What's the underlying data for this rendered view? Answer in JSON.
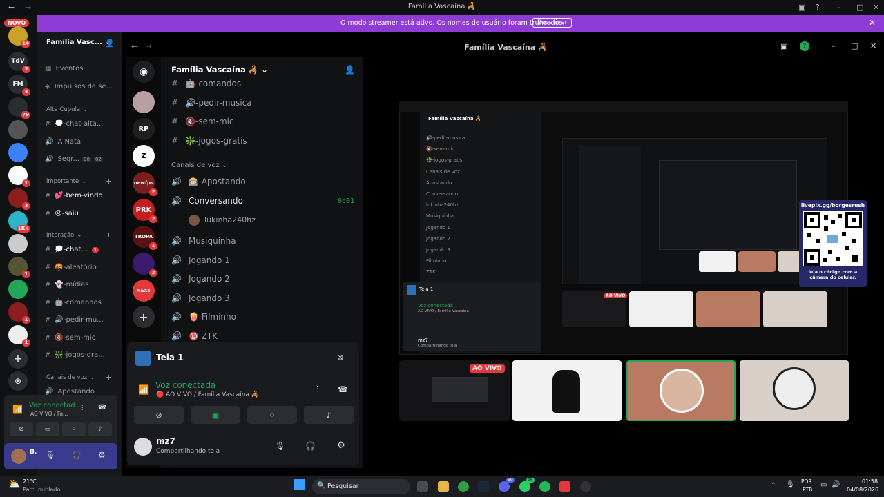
{
  "window": {
    "title": "Família Vascaína 🦂"
  },
  "banner": {
    "message": "O modo streamer está ativo. Os nomes de usuário foram truncados.",
    "button": "Desativar"
  },
  "rail": {
    "novo": "NOVO",
    "servers": [
      {
        "label": "",
        "badge": "14"
      },
      {
        "label": "TdV",
        "badge": "3"
      },
      {
        "label": "FM",
        "badge": "4"
      },
      {
        "label": "",
        "badge": "79"
      },
      {
        "label": "",
        "badge": ""
      },
      {
        "label": "",
        "badge": ""
      },
      {
        "label": "",
        "badge": "1"
      },
      {
        "label": "",
        "badge": "3"
      },
      {
        "label": "",
        "badge": "1K+"
      },
      {
        "label": "",
        "badge": ""
      },
      {
        "label": "",
        "badge": "1"
      },
      {
        "label": "",
        "badge": ""
      },
      {
        "label": "",
        "badge": "1"
      },
      {
        "label": "",
        "badge": "1"
      }
    ]
  },
  "sidebar": {
    "server_name": "Família Vasc...",
    "events": "Eventos",
    "boosts": "Impulsos de se...",
    "categories": [
      {
        "name": "Alta Cupula",
        "channels": [
          {
            "icon": "#",
            "label": "💭-chat-alta..."
          },
          {
            "icon": "🔊",
            "label": "A Nata"
          },
          {
            "icon": "🔊",
            "label": "Segr...",
            "extra": [
              "00",
              "02"
            ]
          }
        ]
      },
      {
        "name": "importante",
        "channels": [
          {
            "icon": "#",
            "label": "💕-bem-vindo",
            "unread": true
          },
          {
            "icon": "#",
            "label": "😞-saiu",
            "unread": true
          }
        ]
      },
      {
        "name": "Interação",
        "channels": [
          {
            "icon": "#",
            "label": "💭-chat...",
            "unread": true,
            "badge": "1"
          },
          {
            "icon": "#",
            "label": "🤬-aleatório"
          },
          {
            "icon": "#",
            "label": "👻-mídias"
          },
          {
            "icon": "#",
            "label": "🤖-comandos"
          },
          {
            "icon": "#",
            "label": "🔊-pedir-mu..."
          },
          {
            "icon": "#",
            "label": "🔇-sem-mic"
          },
          {
            "icon": "#",
            "label": "❇️-jogos-gra..."
          }
        ]
      },
      {
        "name": "Canais de voz",
        "channels": [
          {
            "icon": "🔊",
            "label": "Apostando"
          }
        ]
      }
    ],
    "voice_status": "Voz conectad...",
    "voice_sub": "AO VIVO / Fa...",
    "user_initial": "B."
  },
  "inner": {
    "title": "Família Vascaína 🦂",
    "server_name": "Família Vascaína 🦂",
    "rail_badges": [
      "",
      "",
      "2",
      "2",
      "1",
      "3",
      ""
    ],
    "rail_labels": [
      "",
      "RP",
      "Z",
      "newfps",
      "PRK",
      "TROPA",
      "",
      "NEXT"
    ],
    "channels": [
      {
        "label": "🤖-comandos"
      },
      {
        "label": "🔊-pedir-musica"
      },
      {
        "label": "🔇-sem-mic"
      },
      {
        "label": "❇️-jogos-gratis"
      }
    ],
    "voice_category": "Canais de voz",
    "voice_channels": [
      {
        "label": "🎰 Apostando"
      },
      {
        "label": "Conversando",
        "time": "0:01",
        "active": true
      },
      {
        "label": "Musiquinha"
      },
      {
        "label": "Jogando 1"
      },
      {
        "label": "Jogando 2"
      },
      {
        "label": "Jogando 3"
      },
      {
        "label": "🍿 Filminho"
      },
      {
        "label": "🎯 ZTK"
      }
    ],
    "voice_user": "lukinha240hz",
    "screen_label": "Tela 1",
    "voice_status": "Voz conectada",
    "voice_sub": "🔴 AO VIVO / Família Vascaína 🦂",
    "username": "mz7",
    "user_status": "Compartilhando tela"
  },
  "stage": {
    "live_label": "AO VIVO",
    "qr_title": "livepix.gg/borgesrush",
    "qr_caption": "leia o código com a câmera do celular.",
    "mini_channels": [
      "🔊-pedir-musica",
      "🔇-sem-mic",
      "❇️-jogos-gratis",
      "Canais de voz",
      "Apostando",
      "Conversando",
      "lukinha240hz",
      "Musiquinha",
      "Jogando 1",
      "Jogando 2",
      "Jogando 3",
      "Filminho",
      "ZTK"
    ],
    "mini_tela": "Tela 1",
    "mini_voice": "Voz conectada",
    "mini_voice_sub": "AO VIVO / Família Vascaína",
    "mini_user": "mz7",
    "mini_user_status": "Compartilhando tela"
  },
  "taskbar": {
    "weather_temp": "21°C",
    "weather_desc": "Parc. nublado",
    "search": "Pesquisar",
    "lang": "POR",
    "lang2": "PTB",
    "time": "01:58",
    "date": "04/08/2026",
    "badge_discord": "59",
    "badge_whatsapp": "16"
  }
}
